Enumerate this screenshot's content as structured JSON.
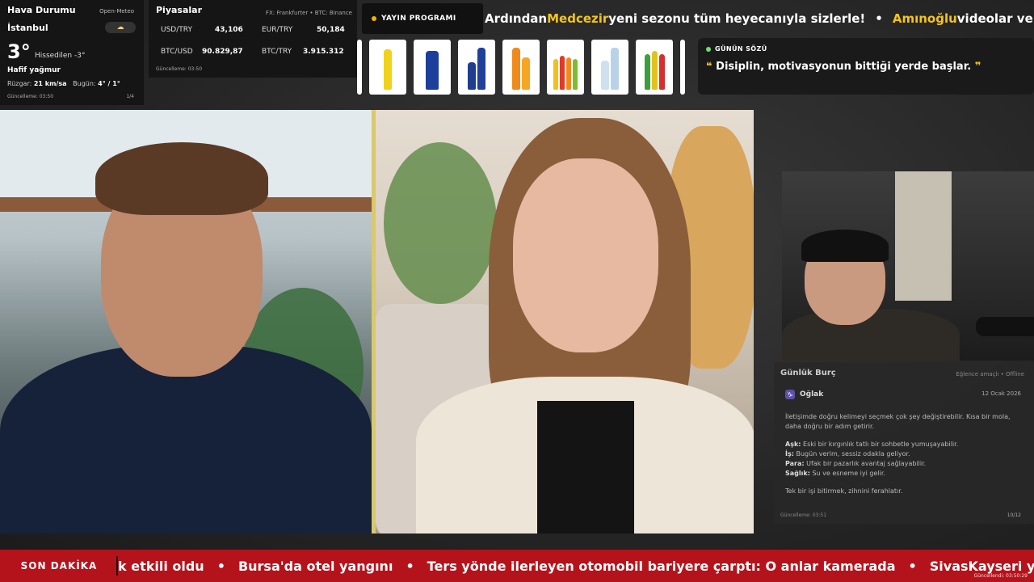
{
  "weather": {
    "title": "Hava Durumu",
    "source": "Open-Meteo",
    "city": "İstanbul",
    "temperature": "3°",
    "feels_like": "Hissedilen -3°",
    "condition": "Hafif yağmur",
    "wind_label": "Rüzgar:",
    "wind_value": "21 km/sa",
    "today_label": "Bugün:",
    "today_value": "4° / 1°",
    "updated": "Güncelleme: 03:50",
    "page": "1/4",
    "icon": "cloud-rain-icon"
  },
  "markets": {
    "title": "Piyasalar",
    "source": "FX: Frankfurter • BTC: Binance",
    "usd_label": "USD/TRY",
    "usd_value": "43,106",
    "eur_label": "EUR/TRY",
    "eur_value": "50,184",
    "btcusd_label": "BTC/USD",
    "btcusd_value": "90.829,87",
    "btctry_label": "BTC/TRY",
    "btctry_value": "3.915.312",
    "updated": "Güncelleme: 03:50"
  },
  "schedule": {
    "label": "YAYIN PROGRAMI"
  },
  "top_ticker": {
    "part1": "Ardından ",
    "highlight1": "Medcezir",
    "part2": " yeni sezonu tüm heyecanıyla sizlerle!",
    "sep": "•",
    "highlight2": "Amınoğlu",
    "part3": " videolar ve bi"
  },
  "quote": {
    "label": "GÜNÜN SÖZÜ",
    "open": "❝",
    "text": "Disiplin, motivasyonun bittiği yerde başlar.",
    "close": "❞"
  },
  "horoscope": {
    "title": "Günlük Burç",
    "tag": "Eğlence amaçlı • Offline",
    "sign": "Oğlak",
    "sign_icon": "♑",
    "date": "12 Ocak 2026",
    "intro": "İletişimde doğru kelimeyi seçmek çok şey değiştirebilir. Kısa bir mola, daha doğru bir adım getirir.",
    "love_label": "Aşk:",
    "love": "Eski bir kırgınlık tatlı bir sohbetle yumuşayabilir.",
    "work_label": "İş:",
    "work": "Bugün verim, sessiz odakla geliyor.",
    "money_label": "Para:",
    "money": "Ufak bir pazarlık avantaj sağlayabilir.",
    "health_label": "Sağlık:",
    "health": "Su ve esneme iyi gelir.",
    "outro": "Tek bir işi bitirmek, zihnini ferahlatır.",
    "updated": "Güncelleme: 03:51",
    "page": "10/12"
  },
  "breaking": {
    "label": "SON DAKİKA",
    "items": [
      "k etkili oldu",
      "Bursa'da otel yangını",
      "Ters yönde ilerleyen otomobil bariyere çarptı: O anlar kamerada",
      "SivasKayseri yolu ula"
    ],
    "sep": "•",
    "updated": "Güncellendi: 03:50:29"
  },
  "colors": {
    "accent": "#f5c518",
    "breaking": "#b5131b",
    "quote_dot": "#6fe06f"
  }
}
